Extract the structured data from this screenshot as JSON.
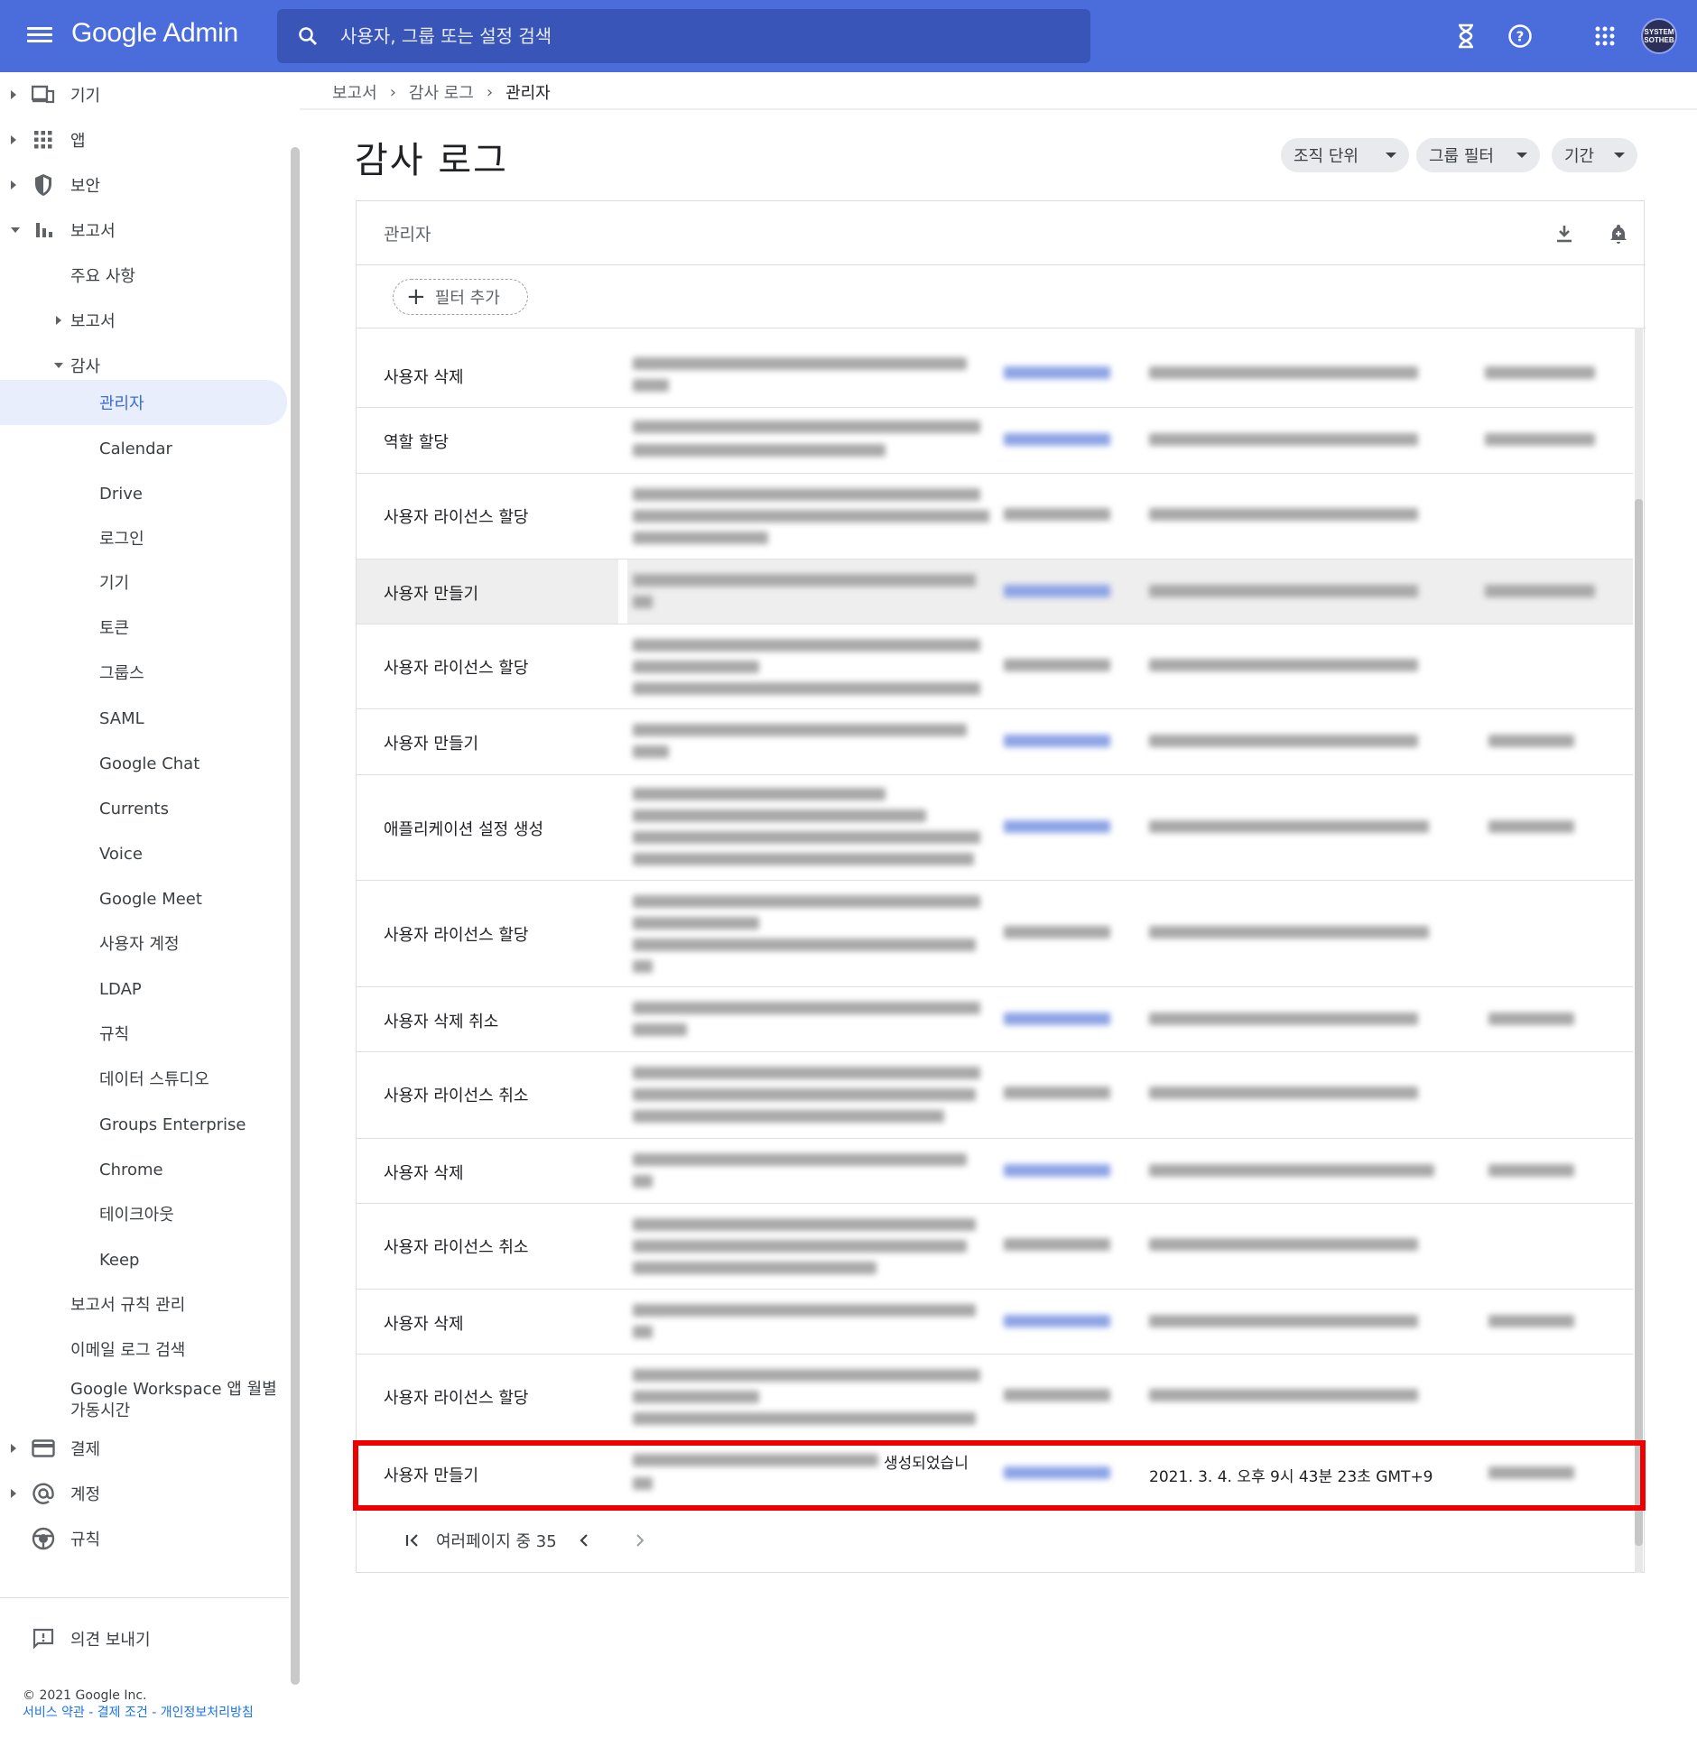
{
  "header": {
    "brand": "Google Admin",
    "search_placeholder": "사용자, 그룹 또는 설정 검색",
    "avatar_text_line1": "SYSTEM",
    "avatar_text_line2": "SOTHEB"
  },
  "sidebar": {
    "items": [
      {
        "label": "기기",
        "icon": "devices-icon",
        "expanded": false
      },
      {
        "label": "앱",
        "icon": "apps-grid-icon",
        "expanded": false
      },
      {
        "label": "보안",
        "icon": "shield-icon",
        "expanded": false
      },
      {
        "label": "보고서",
        "icon": "bar-chart-icon",
        "expanded": true
      }
    ],
    "reports_children": [
      {
        "label": "주요 사항"
      },
      {
        "label": "보고서"
      },
      {
        "label": "감사"
      }
    ],
    "audit_children": [
      {
        "label": "관리자",
        "active": true
      },
      {
        "label": "Calendar"
      },
      {
        "label": "Drive"
      },
      {
        "label": "로그인"
      },
      {
        "label": "기기"
      },
      {
        "label": "토큰"
      },
      {
        "label": "그룹스"
      },
      {
        "label": "SAML"
      },
      {
        "label": "Google Chat"
      },
      {
        "label": "Currents"
      },
      {
        "label": "Voice"
      },
      {
        "label": "Google Meet"
      },
      {
        "label": "사용자 계정"
      },
      {
        "label": "LDAP"
      },
      {
        "label": "규칙"
      },
      {
        "label": "데이터 스튜디오"
      },
      {
        "label": "Groups Enterprise"
      },
      {
        "label": "Chrome"
      },
      {
        "label": "테이크아웃"
      },
      {
        "label": "Keep"
      }
    ],
    "reports_tail": [
      {
        "label": "보고서 규칙 관리"
      },
      {
        "label": "이메일 로그 검색"
      },
      {
        "label": "Google Workspace 앱 월별 가동시간"
      }
    ],
    "bottom_items": [
      {
        "label": "결제",
        "icon": "credit-card-icon"
      },
      {
        "label": "계정",
        "icon": "at-sign-icon"
      },
      {
        "label": "규칙",
        "icon": "rules-icon"
      }
    ],
    "feedback_label": "의견 보내기",
    "footer_copyright": "© 2021 Google Inc.",
    "footer_links": "서비스 약관 - 결제 조건 - 개인정보처리방침"
  },
  "breadcrumb": [
    "보고서",
    "감사 로그",
    "관리자"
  ],
  "page_title": "감사 로그",
  "filter_chips": [
    "조직 단위",
    "그룹 필터",
    "기간"
  ],
  "card": {
    "title": "관리자",
    "add_filter_label": "필터 추가"
  },
  "rows": [
    {
      "event": "사용자 삭제"
    },
    {
      "event": "역할 할당"
    },
    {
      "event": "사용자 라이선스 할당"
    },
    {
      "event": "사용자 만들기"
    },
    {
      "event": "사용자 라이선스 할당"
    },
    {
      "event": "사용자 만들기"
    },
    {
      "event": "애플리케이션 설정 생성"
    },
    {
      "event": "사용자 라이선스 할당"
    },
    {
      "event": "사용자 삭제 취소"
    },
    {
      "event": "사용자 라이선스 취소"
    },
    {
      "event": "사용자 삭제"
    },
    {
      "event": "사용자 라이선스 취소"
    },
    {
      "event": "사용자 삭제"
    },
    {
      "event": "사용자 라이선스 할당"
    },
    {
      "event": "사용자 만들기",
      "description_visible": "생성되었습니",
      "date": "2021. 3. 4. 오후 9시 43분 23초 GMT+9",
      "highlighted": true
    }
  ],
  "pagination": {
    "label": "여러페이지 중 35"
  },
  "colors": {
    "topbar": "#4a6ddb",
    "active_nav": "#e8eefc",
    "highlight_border": "#ee0000"
  }
}
